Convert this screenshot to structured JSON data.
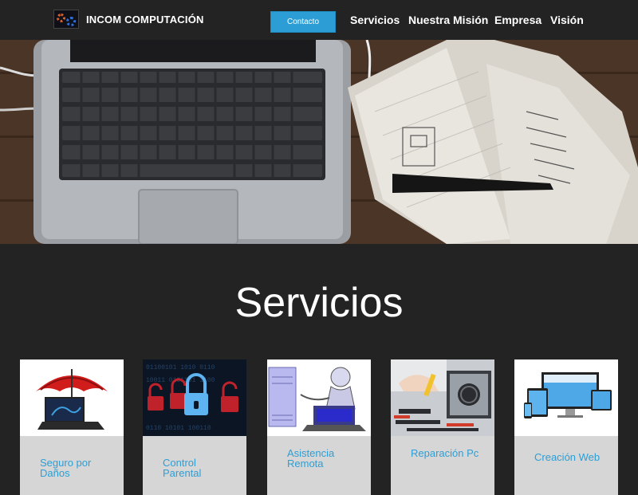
{
  "header": {
    "brand": "INCOM COMPUTACIÓN",
    "contact_label": "Contacto",
    "nav": [
      "Servicios",
      "Nuestra Misión",
      "Empresa",
      "Visión"
    ]
  },
  "section": {
    "title": "Servicios"
  },
  "cards": [
    {
      "label": "Seguro por Daños",
      "icon": "umbrella-laptop-icon"
    },
    {
      "label": "Control Parental",
      "icon": "padlock-icon"
    },
    {
      "label": "Asistencia Remota",
      "icon": "robot-computer-icon"
    },
    {
      "label": "Reparación Pc",
      "icon": "repair-tools-icon"
    },
    {
      "label": "Creación Web",
      "icon": "devices-icon"
    }
  ],
  "colors": {
    "accent": "#2d9ed5",
    "background": "#232323",
    "card": "#d6d6d6"
  }
}
